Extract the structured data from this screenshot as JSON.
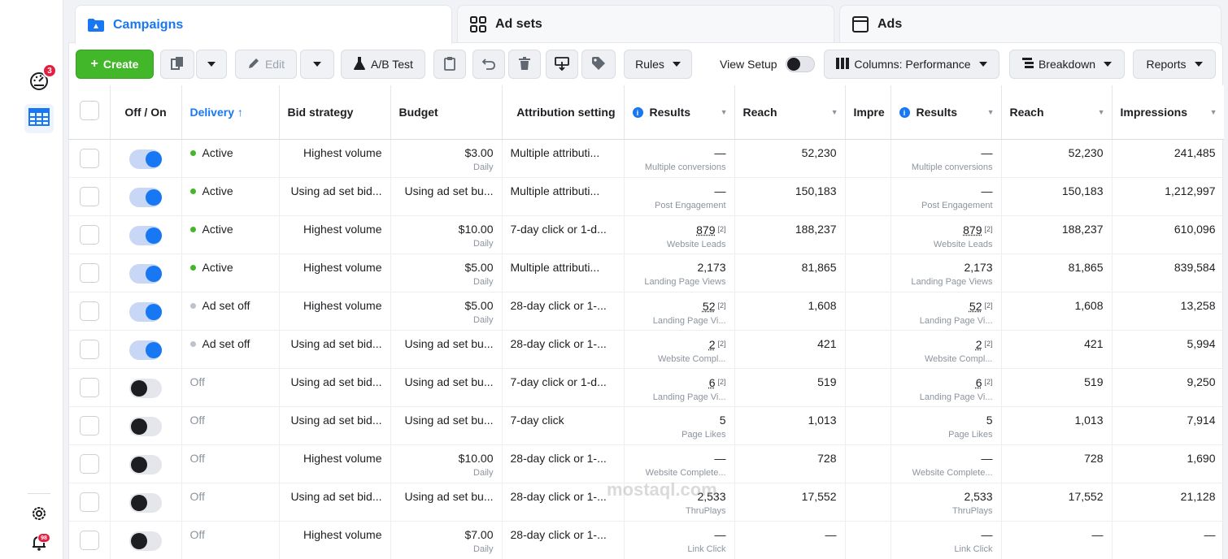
{
  "rail": {
    "notifications_badge": "3",
    "alerts_badge": "98"
  },
  "tabs": [
    {
      "label": "Campaigns"
    },
    {
      "label": "Ad sets"
    },
    {
      "label": "Ads"
    }
  ],
  "toolbar": {
    "create": "Create",
    "edit": "Edit",
    "ab_test": "A/B Test",
    "rules": "Rules",
    "view_setup": "View Setup",
    "columns": "Columns: Performance",
    "breakdown": "Breakdown",
    "reports": "Reports"
  },
  "columns": {
    "off_on": "Off / On",
    "delivery": "Delivery",
    "delivery_sort": "↑",
    "bid_strategy": "Bid strategy",
    "budget": "Budget",
    "attribution": "Attribution setting",
    "results": "Results",
    "reach": "Reach",
    "impressions_short": "Impre",
    "results2": "Results",
    "reach2": "Reach",
    "impressions": "Impressions"
  },
  "rows": [
    {
      "on": true,
      "delivery": "Active",
      "dstate": "active",
      "bid": "Highest volume",
      "budget": "$3.00",
      "budget_sub": "Daily",
      "attribution": "Multiple attributi...",
      "result": "—",
      "result_sub": "Multiple conversions",
      "reach": "52,230",
      "impressions": "241,485"
    },
    {
      "on": true,
      "delivery": "Active",
      "dstate": "active",
      "bid": "Using ad set bid...",
      "budget": "Using ad set bu...",
      "budget_sub": "",
      "attribution": "Multiple attributi...",
      "result": "—",
      "result_sub": "Post Engagement",
      "reach": "150,183",
      "impressions": "1,212,997"
    },
    {
      "on": true,
      "delivery": "Active",
      "dstate": "active",
      "bid": "Highest volume",
      "budget": "$10.00",
      "budget_sub": "Daily",
      "attribution": "7-day click or 1-d...",
      "result": "879",
      "result_mark": "[2]",
      "result_sub": "Website Leads",
      "reach": "188,237",
      "impressions": "610,096"
    },
    {
      "on": true,
      "delivery": "Active",
      "dstate": "active",
      "bid": "Highest volume",
      "budget": "$5.00",
      "budget_sub": "Daily",
      "attribution": "Multiple attributi...",
      "result": "2,173",
      "result_sub": "Landing Page Views",
      "reach": "81,865",
      "impressions": "839,584"
    },
    {
      "on": true,
      "delivery": "Ad set off",
      "dstate": "paused",
      "bid": "Highest volume",
      "budget": "$5.00",
      "budget_sub": "Daily",
      "attribution": "28-day click or 1-...",
      "result": "52",
      "result_mark": "[2]",
      "result_sub": "Landing Page Vi...",
      "reach": "1,608",
      "impressions": "13,258"
    },
    {
      "on": true,
      "delivery": "Ad set off",
      "dstate": "paused",
      "bid": "Using ad set bid...",
      "budget": "Using ad set bu...",
      "budget_sub": "",
      "attribution": "28-day click or 1-...",
      "result": "2",
      "result_mark": "[2]",
      "result_sub": "Website Compl...",
      "reach": "421",
      "impressions": "5,994"
    },
    {
      "on": false,
      "delivery": "Off",
      "dstate": "off",
      "bid": "Using ad set bid...",
      "budget": "Using ad set bu...",
      "budget_sub": "",
      "attribution": "7-day click or 1-d...",
      "result": "6",
      "result_mark": "[2]",
      "result_sub": "Landing Page Vi...",
      "reach": "519",
      "impressions": "9,250"
    },
    {
      "on": false,
      "delivery": "Off",
      "dstate": "off",
      "bid": "Using ad set bid...",
      "budget": "Using ad set bu...",
      "budget_sub": "",
      "attribution": "7-day click",
      "result": "5",
      "result_sub": "Page Likes",
      "reach": "1,013",
      "impressions": "7,914"
    },
    {
      "on": false,
      "delivery": "Off",
      "dstate": "off",
      "bid": "Highest volume",
      "budget": "$10.00",
      "budget_sub": "Daily",
      "attribution": "28-day click or 1-...",
      "result": "—",
      "result_sub": "Website Complete...",
      "reach": "728",
      "impressions": "1,690"
    },
    {
      "on": false,
      "delivery": "Off",
      "dstate": "off",
      "bid": "Using ad set bid...",
      "budget": "Using ad set bu...",
      "budget_sub": "",
      "attribution": "28-day click or 1-...",
      "result": "2,533",
      "result_sub": "ThruPlays",
      "reach": "17,552",
      "impressions": "21,128"
    },
    {
      "on": false,
      "delivery": "Off",
      "dstate": "off",
      "bid": "Highest volume",
      "budget": "$7.00",
      "budget_sub": "Daily",
      "attribution": "28-day click or 1-...",
      "result": "—",
      "result_sub": "Link Click",
      "reach": "—",
      "impressions": "—",
      "reach2": "—"
    }
  ],
  "watermark": "mostaql.com",
  "colors": {
    "accent": "#1877f2",
    "create_green": "#42b72a",
    "active_dot": "#42b72a",
    "paused_dot": "#bec3c9",
    "badge_red": "#e41e3f"
  }
}
